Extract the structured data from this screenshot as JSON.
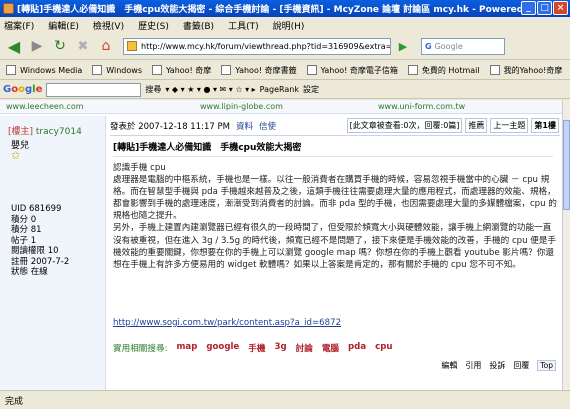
{
  "window": {
    "title": "[轉貼]手機達人必備知識　手機cpu效能大揭密 - 綜合手機討論 - [手機資訊] - McyZone 論壇 討論區 mcy.hk - Powered ..."
  },
  "menu": [
    "檔案(F)",
    "編輯(E)",
    "檢視(V)",
    "歷史(S)",
    "書籤(B)",
    "工具(T)",
    "說明(H)"
  ],
  "nav": {
    "url": "http://www.mcy.hk/forum/viewthread.php?tid=316909&extra=page%3D",
    "search_placeholder": "Google",
    "search_icon_label": "G"
  },
  "bookmarks": [
    "Windows Media",
    "Windows",
    "Yahoo! 奇摩",
    "Yahoo! 奇摩書籤",
    "Yahoo! 奇摩電子信箱",
    "免費的 Hotmail",
    "我的Yahoo!奇摩"
  ],
  "google_toolbar": {
    "logo": [
      "G",
      "o",
      "o",
      "g",
      "l",
      "e"
    ],
    "search_label": "搜尋",
    "pagerank_label": "PageRank",
    "settings_label": "設定"
  },
  "banner": {
    "left": "www.leecheen.com",
    "mid": "www.lipin-globe.com",
    "right": "www.uni-form.com.tw"
  },
  "post": {
    "author_tag": "[樓主]",
    "author": "tracy7014",
    "rank": "嬰兒",
    "stats": [
      "UID 681699",
      "積分 0",
      "積分 81",
      "帖子 1",
      "閱讀權限 10",
      "註冊 2007-7-2",
      "狀態 在線"
    ],
    "meta": "發表於 2007-12-18 11:17 PM",
    "meta_link1": "資料",
    "meta_link2": "信使",
    "nav": [
      "[此文章被查看:0次，回覆:0篇]",
      "推薦",
      "上一主題",
      "第1樓"
    ],
    "title": "[轉貼]手機達人必備知識　手機cpu效能大揭密",
    "paragraphs": [
      "認識手機 cpu",
      "處理器是電腦的中樞系統，手機也是一樣。以往一般消費者在購買手機的時候，容易忽視手機當中的心臟 － cpu 規格。而在智慧型手機與 pda 手機越來越普及之後，這類手機往往需要處理大量的應用程式，而處理器的效能、規格，都會影響到手機的處理速度，漸漸受到消費者的討論。而非 pda 型的手機，也因需要處理大量的多媒體檔案，cpu 的規格也隨之提升。",
      "另外，手機上建置內建瀏覽器已經有很久的一段時間了，但受限於頻寬大小與硬體效能，讓手機上網瀏覽的功能一直沒有被重視，但在進入 3g / 3.5g 的時代後，頻寬已經不是問題了，接下來便是手機效能的改善，手機的 cpu 便是手機效能的重要關鍵，你想要在你的手機上可以瀏覽 google map 嗎？你想在你的手機上觀看 youtube 影片嗎？你還想在手機上有許多方便易用的 widget 軟體嗎？如果以上答案是肯定的，那有關於手機的 cpu 您不可不知。"
    ],
    "link": "http://www.sogi.com.tw/park/content.asp?a_id=6872",
    "keywords_label": "實用相關搜尋:",
    "keywords": [
      "map",
      "google",
      "手機",
      "3g",
      "討論",
      "電腦",
      "pda",
      "cpu"
    ],
    "actions": [
      "編輯",
      "引用",
      "投訴",
      "回覆",
      "Top"
    ]
  },
  "status": {
    "text": "完成"
  },
  "colors": {
    "titlebar": "#0a5fe0",
    "link": "#1f3f9a",
    "keyword": "#b0202a",
    "accent_green": "#2a7a2a"
  }
}
